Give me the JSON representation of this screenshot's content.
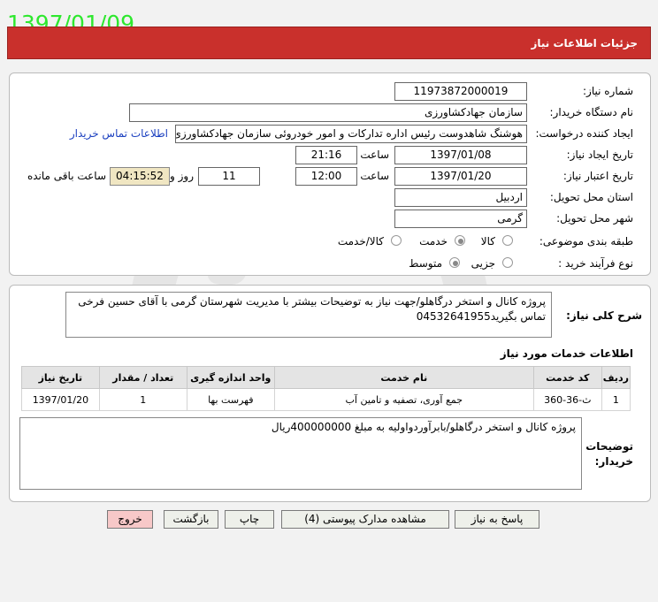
{
  "stamp_date": "1397/01/09",
  "header": {
    "title": "جزئیات اطلاعات نیاز"
  },
  "form": {
    "need_number": {
      "label": "شماره نیاز:",
      "value": "11973872000019"
    },
    "buyer_org": {
      "label": "نام دستگاه خریدار:",
      "value": "سازمان جهادکشاورزی"
    },
    "requester": {
      "label": "ایجاد کننده درخواست:",
      "value": "هوشنگ شاهدوست رئیس اداره تدارکات و امور خودروئی سازمان جهادکشاورزی",
      "contact_link": "اطلاعات تماس خریدار"
    },
    "created": {
      "label": "تاریخ ایجاد نیاز:",
      "date": "1397/01/08",
      "time_label": "ساعت",
      "time": "21:16"
    },
    "validity": {
      "label": "تاریخ اعتبار نیاز:",
      "date": "1397/01/20",
      "time_label": "ساعت",
      "time": "12:00",
      "days": "11",
      "days_label": "روز و",
      "remaining_time": "04:15:52",
      "remaining_label": "ساعت باقی مانده"
    },
    "province": {
      "label": "استان محل تحویل:",
      "value": "اردبیل"
    },
    "city": {
      "label": "شهر محل تحویل:",
      "value": "گرمی"
    },
    "category": {
      "label": "طبقه بندی موضوعی:",
      "options": [
        "کالا",
        "خدمت",
        "کالا/خدمت"
      ],
      "selected": "خدمت"
    },
    "process": {
      "label": "نوع فرآیند خرید :",
      "options": [
        "جزیی",
        "متوسط"
      ],
      "selected": "متوسط"
    }
  },
  "summary": {
    "label": "شرح کلی نیاز:",
    "text_line1": "پروژه کانال و استخر درگاهلو/جهت نیاز به توضیحات بیشتر با مدیریت شهرستان گرمی با آقای حسین فرخی",
    "text_line2": "تماس بگیرید04532641955"
  },
  "services": {
    "title": "اطلاعات خدمات مورد نیاز",
    "columns": [
      "ردیف",
      "کد خدمت",
      "نام خدمت",
      "واحد اندازه گیری",
      "تعداد / مقدار",
      "تاریخ نیاز"
    ],
    "rows": [
      [
        "1",
        "ث-36-360",
        "جمع آوری، تصفیه و تامین آب",
        "فهرست بها",
        "1",
        "1397/01/20"
      ]
    ]
  },
  "buyer_notes": {
    "label_line1": "توضیحات",
    "label_line2": "خریدار:",
    "text": "پروژه کانال و استخر درگاهلو/بابرآوردواولیه به مبلغ 400000000ریال"
  },
  "buttons": {
    "reply": "پاسخ به نیاز",
    "attachments": "مشاهده مدارک پیوستی (4)",
    "print": "چاپ",
    "back": "بازگشت",
    "exit": "خروج"
  },
  "colors": {
    "header": "#c9302c",
    "stamp": "#2ee82e",
    "link": "#1a3fbf",
    "timer_bg": "#f0e6c2",
    "exit_bg": "#f7c8c8"
  }
}
